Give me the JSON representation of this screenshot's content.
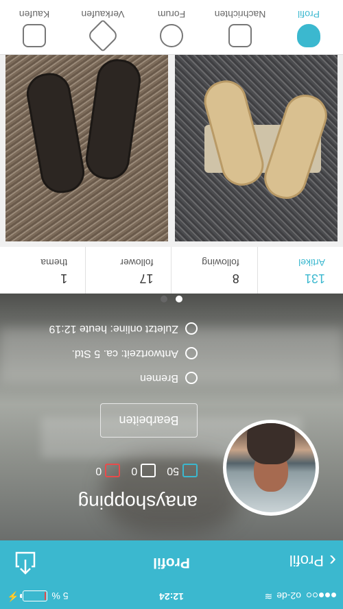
{
  "status_bar": {
    "carrier": "o2-de",
    "time": "12:24",
    "battery": "5 %",
    "battery_level": 0.05
  },
  "navbar": {
    "back_label": "Profil",
    "title": "Profil"
  },
  "profile": {
    "username": "anayshopping",
    "counters": {
      "positive": "50",
      "neutral": "0",
      "negative": "0"
    },
    "edit_label": "Bearbeiten",
    "location": "Bremen",
    "response_time": "Antwortzeit: ca. 5 Std.",
    "last_online": "Zuletzt online: heute 12:19"
  },
  "stats": [
    {
      "value": "131",
      "label": "Artikel"
    },
    {
      "value": "8",
      "label": "following"
    },
    {
      "value": "17",
      "label": "follower"
    },
    {
      "value": "1",
      "label": "thema"
    }
  ],
  "tabs": [
    {
      "label": "Kaufen",
      "icon": "basket-icon"
    },
    {
      "label": "Verkaufen",
      "icon": "tag-icon"
    },
    {
      "label": "Forum",
      "icon": "chat-bubble-icon"
    },
    {
      "label": "Nachrichten",
      "icon": "inbox-icon"
    },
    {
      "label": "Profil",
      "icon": "profile-icon"
    }
  ],
  "colors": {
    "accent": "#3bb8cf",
    "negative": "#e84b4b"
  }
}
